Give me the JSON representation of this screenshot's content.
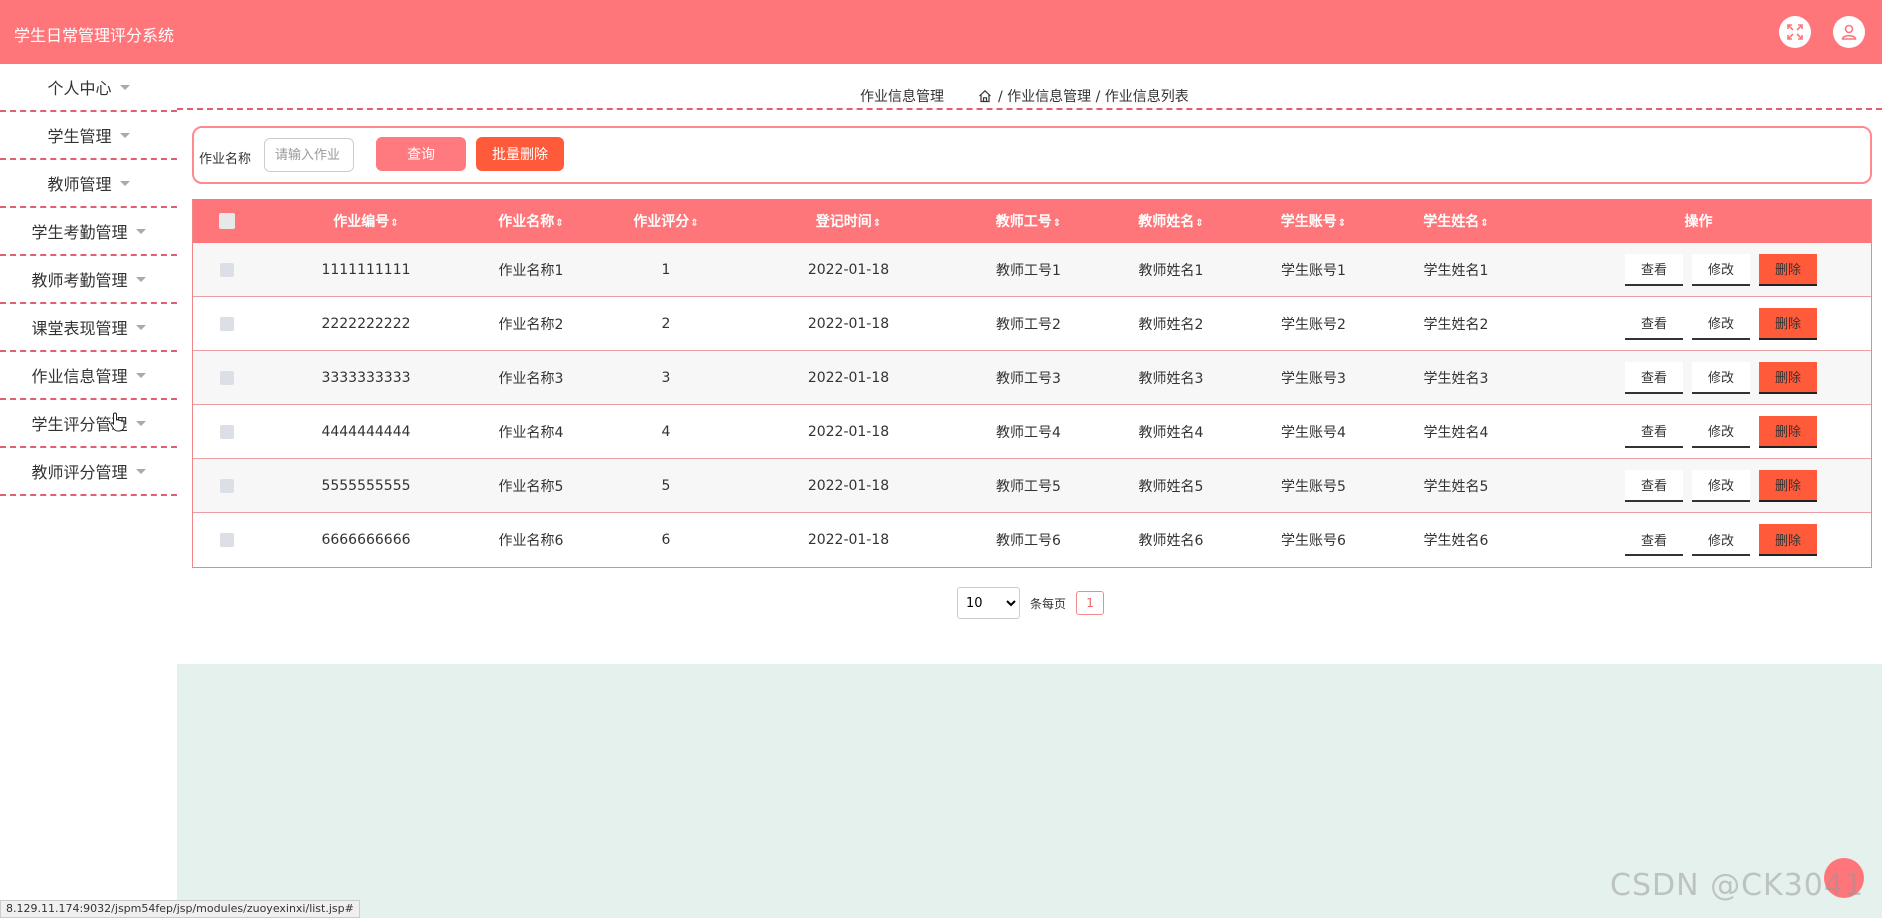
{
  "app": {
    "title": "学生日常管理评分系统"
  },
  "header_icons": [
    "fullscreen-icon",
    "user-icon"
  ],
  "sidebar": {
    "items": [
      {
        "label": "个人中心"
      },
      {
        "label": "学生管理"
      },
      {
        "label": "教师管理"
      },
      {
        "label": "学生考勤管理"
      },
      {
        "label": "教师考勤管理"
      },
      {
        "label": "课堂表现管理"
      },
      {
        "label": "作业信息管理"
      },
      {
        "label": "学生评分管理"
      },
      {
        "label": "教师评分管理"
      }
    ]
  },
  "breadcrumb": {
    "title": "作业信息管理",
    "path": "/ 作业信息管理 / 作业信息列表"
  },
  "search": {
    "label": "作业名称",
    "placeholder": "请输入作业",
    "query_label": "查询",
    "batch_delete_label": "批量删除"
  },
  "table": {
    "columns": [
      "作业编号",
      "作业名称",
      "作业评分",
      "登记时间",
      "教师工号",
      "教师姓名",
      "学生账号",
      "学生姓名"
    ],
    "ops_header": "操作",
    "sort_glyph": "⇕",
    "rows": [
      {
        "no": "1111111111",
        "name": "作业名称1",
        "score": "1",
        "date": "2022-01-18",
        "teacher_id": "教师工号1",
        "teacher_name": "教师姓名1",
        "student_account": "学生账号1",
        "student_name": "学生姓名1"
      },
      {
        "no": "2222222222",
        "name": "作业名称2",
        "score": "2",
        "date": "2022-01-18",
        "teacher_id": "教师工号2",
        "teacher_name": "教师姓名2",
        "student_account": "学生账号2",
        "student_name": "学生姓名2"
      },
      {
        "no": "3333333333",
        "name": "作业名称3",
        "score": "3",
        "date": "2022-01-18",
        "teacher_id": "教师工号3",
        "teacher_name": "教师姓名3",
        "student_account": "学生账号3",
        "student_name": "学生姓名3"
      },
      {
        "no": "4444444444",
        "name": "作业名称4",
        "score": "4",
        "date": "2022-01-18",
        "teacher_id": "教师工号4",
        "teacher_name": "教师姓名4",
        "student_account": "学生账号4",
        "student_name": "学生姓名4"
      },
      {
        "no": "5555555555",
        "name": "作业名称5",
        "score": "5",
        "date": "2022-01-18",
        "teacher_id": "教师工号5",
        "teacher_name": "教师姓名5",
        "student_account": "学生账号5",
        "student_name": "学生姓名5"
      },
      {
        "no": "6666666666",
        "name": "作业名称6",
        "score": "6",
        "date": "2022-01-18",
        "teacher_id": "教师工号6",
        "teacher_name": "教师姓名6",
        "student_account": "学生账号6",
        "student_name": "学生姓名6"
      }
    ],
    "actions": {
      "view": "查看",
      "edit": "修改",
      "delete": "删除"
    }
  },
  "pagination": {
    "page_size": "10",
    "page_size_options": [
      "10"
    ],
    "per_page_label": "条每页",
    "current_page": "1"
  },
  "status_url": "8.129.11.174:9032/jspm54fep/jsp/modules/zuoyexinxi/list.jsp#",
  "watermark": "CSDN @CK3041",
  "colors": {
    "primary": "#ff767a",
    "danger": "#ff5a3a",
    "bottom_bg": "#e5f1ed"
  }
}
